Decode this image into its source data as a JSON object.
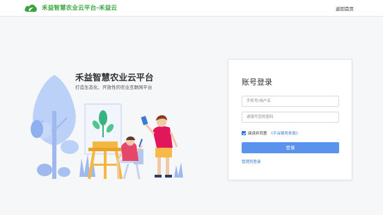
{
  "header": {
    "brand": "禾益智慧农业云平台-禾益云",
    "home_link": "返回首页"
  },
  "hero": {
    "title": "禾益智慧农业云平台",
    "subtitle": "打造生态化、开放性的农业互联网平台"
  },
  "login": {
    "title": "账号登录",
    "username_placeholder": "手机号/用户名",
    "password_placeholder": "请填写您的密码",
    "agree_text": "阅读并同意",
    "terms_link": "《平台服务条款》",
    "agree_checked": true,
    "submit_label": "登录",
    "admin_link": "管理员登录"
  },
  "icons": {
    "logo": "cloud-leaf-icon",
    "checkbox": "check-icon"
  },
  "colors": {
    "brand": "#3aa53f",
    "primary": "#5b92ee",
    "link": "#3a7bd5",
    "background": "#f6f7f9"
  }
}
